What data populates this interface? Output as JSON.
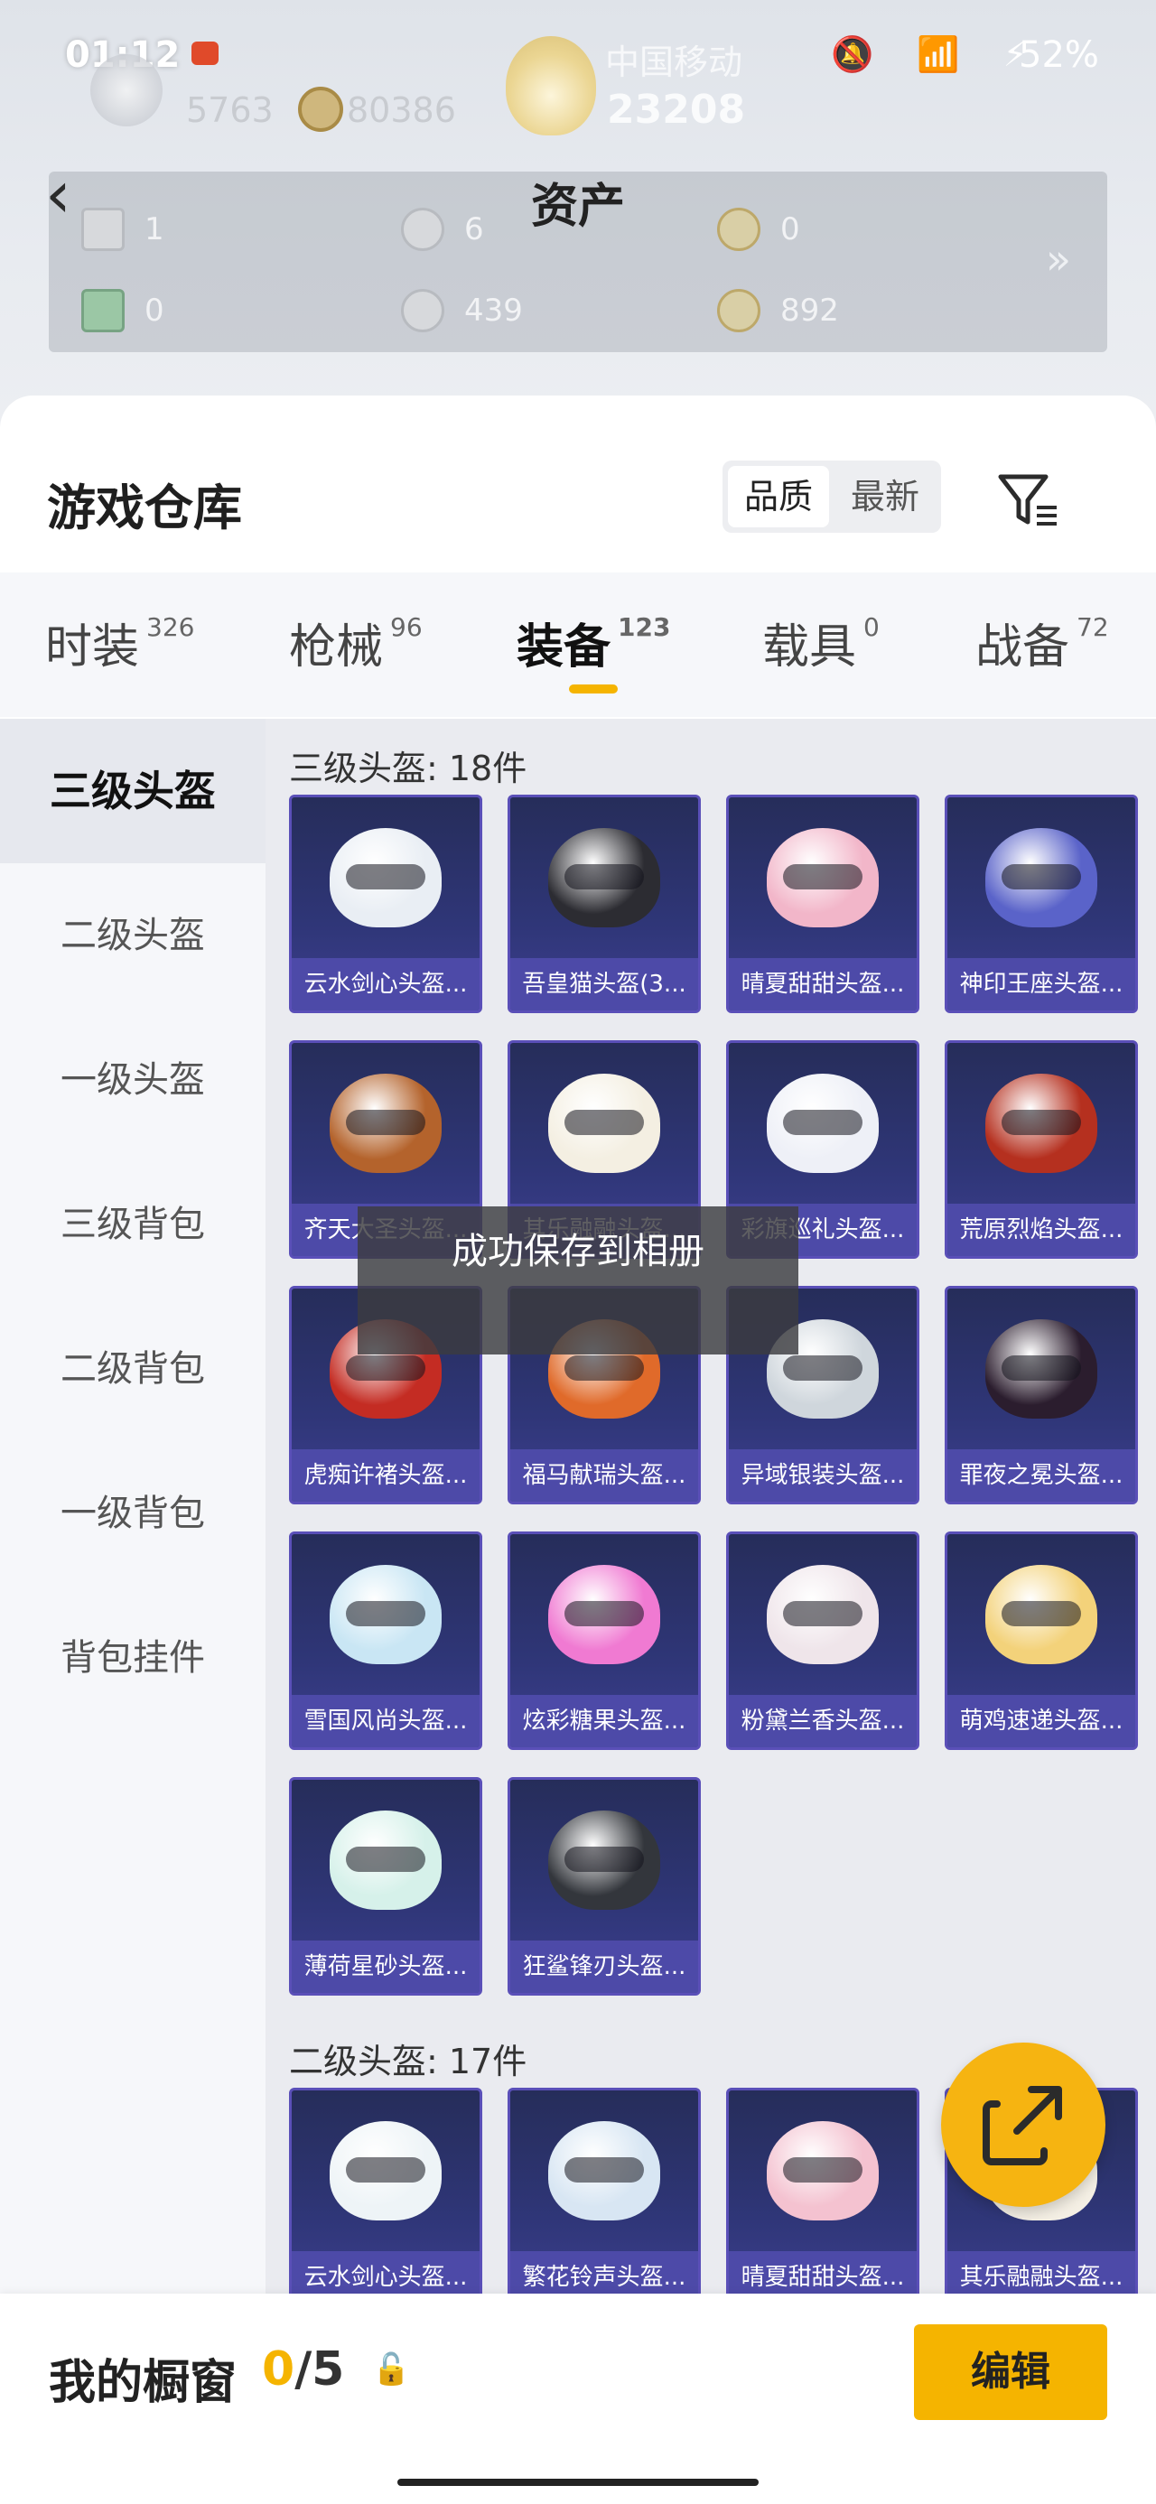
{
  "status_bar": {
    "time": "01:12",
    "carrier": "中国移动",
    "icons": "🔕 📶 ⚡",
    "battery": "52%"
  },
  "profile": {
    "stat_a": "5763",
    "stat_b": "80386",
    "stat_c": "23208"
  },
  "header": {
    "back": "‹",
    "title": "资产"
  },
  "assets": [
    {
      "value": "1",
      "icon": "card-icon"
    },
    {
      "value": "6",
      "icon": "silver-coin-icon"
    },
    {
      "value": "0",
      "icon": "gold-coin-icon"
    },
    {
      "value": "0",
      "icon": "green-ticket-icon"
    },
    {
      "value": "439",
      "icon": "silver-coin-icon"
    },
    {
      "value": "892",
      "icon": "bronze-coin-icon"
    }
  ],
  "assets_arrow": "»",
  "warehouse": {
    "title": "游戏仓库",
    "sort_options": [
      "品质",
      "最新"
    ],
    "filter_icon": "filter-icon"
  },
  "tabs": [
    {
      "label": "时装",
      "count": "326"
    },
    {
      "label": "枪械",
      "count": "96"
    },
    {
      "label": "装备",
      "count": "123",
      "active": true
    },
    {
      "label": "载具",
      "count": "0"
    },
    {
      "label": "战备",
      "count": "72"
    }
  ],
  "sidebar": [
    "三级头盔",
    "二级头盔",
    "一级头盔",
    "三级背包",
    "二级背包",
    "一级背包",
    "背包挂件"
  ],
  "sections": [
    {
      "title": "三级头盔: 18件",
      "items": [
        "云水剑心头盔...",
        "吾皇猫头盔(3...",
        "晴夏甜甜头盔...",
        "神印王座头盔...",
        "齐天大圣头盔...",
        "其乐融融头盔...",
        "彩旗巡礼头盔...",
        "荒原烈焰头盔...",
        "虎痴许褚头盔...",
        "福马献瑞头盔...",
        "异域银装头盔...",
        "罪夜之冕头盔...",
        "雪国风尚头盔...",
        "炫彩糖果头盔...",
        "粉黛兰香头盔...",
        "萌鸡速递头盔...",
        "薄荷星砂头盔...",
        "狂鲨锋刃头盔..."
      ]
    },
    {
      "title": "二级头盔: 17件",
      "items": [
        "云水剑心头盔...",
        "繁花铃声头盔...",
        "晴夏甜甜头盔...",
        "其乐融融头盔..."
      ]
    }
  ],
  "helmet_colors": [
    "#e9eef4",
    "#2c2c32",
    "#f2b6c9",
    "#5a63c9",
    "#b4632c",
    "#f4efe2",
    "#eef0f7",
    "#b5301f",
    "#c42c23",
    "#e06a2a",
    "#cfd6dc",
    "#2b1d2e",
    "#c9e6f4",
    "#f07ad2",
    "#efe5ea",
    "#f3d27a",
    "#d6f1ea",
    "#33363c",
    "#eef4f7",
    "#d8e6f3",
    "#f4c2d0",
    "#f4efe4"
  ],
  "toast": "成功保存到相册",
  "fab_icon": "share-icon",
  "showcase": {
    "title": "我的橱窗",
    "current": "0",
    "total": "/5",
    "lock_icon": "🔓",
    "edit_label": "编辑"
  }
}
